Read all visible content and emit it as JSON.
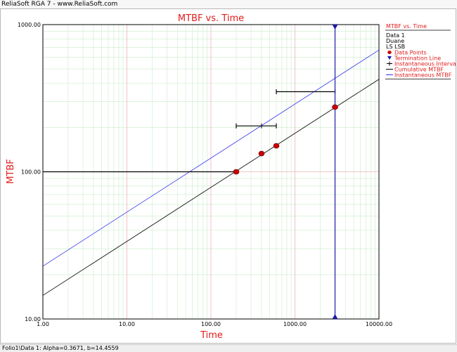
{
  "app": {
    "title": "ReliaSoft RGA 7 - www.ReliaSoft.com",
    "status": "Folio1\\Data 1: Alpha=0.3671, b=14.4559"
  },
  "chart_data": {
    "type": "scatter",
    "title": "MTBF vs. Time",
    "xlabel": "Time",
    "ylabel": "MTBF",
    "xscale": "log",
    "yscale": "log",
    "xlim": [
      1,
      10000
    ],
    "ylim": [
      10,
      1000
    ],
    "x_ticks": [
      "1.00",
      "10.00",
      "100.00",
      "1000.00",
      "10000.00"
    ],
    "y_ticks": [
      "10.00",
      "100.00",
      "1000.00"
    ],
    "grid": true,
    "data_points": [
      {
        "x": 200,
        "y": 100
      },
      {
        "x": 400,
        "y": 133
      },
      {
        "x": 600,
        "y": 150
      },
      {
        "x": 3000,
        "y": 275
      }
    ],
    "termination_time": 3000,
    "instantaneous_intervals": [
      {
        "x0": 1,
        "x1": 200,
        "y": 100,
        "mark": 200
      },
      {
        "x0": 200,
        "x1": 600,
        "y": 205,
        "mark": 400
      },
      {
        "x0": 600,
        "x1": 3000,
        "y": 350,
        "mark": 3000
      }
    ],
    "cumulative_mtbf": {
      "x": [
        1,
        10000
      ],
      "y": [
        14.46,
        425
      ]
    },
    "instantaneous_mtbf": {
      "x": [
        1,
        10000
      ],
      "y": [
        22.85,
        672
      ]
    },
    "legend": {
      "title": "MTBF vs. Time",
      "info": [
        "Data 1",
        "Duane",
        "LS LSB"
      ],
      "items": [
        {
          "label": "Data Points",
          "kind": "point",
          "color": "#cc0000"
        },
        {
          "label": "Termination Line",
          "kind": "triangle",
          "color": "#1a1aa8"
        },
        {
          "label": "Instantaneous Intervals",
          "kind": "interval",
          "color": "#000000"
        },
        {
          "label": "Cumulative MTBF",
          "kind": "line",
          "color": "#000000"
        },
        {
          "label": "Instantaneous MTBF",
          "kind": "line",
          "color": "#3333ee"
        }
      ]
    },
    "colors": {
      "title": "#e31b1b",
      "major_grid": "#f2b3b3",
      "minor_grid": "#c9ecc9",
      "point": "#cc0000",
      "termination": "#1a1aa8",
      "cumulative": "#000000",
      "instantaneous": "#3333ee",
      "intervals": "#000000"
    }
  }
}
